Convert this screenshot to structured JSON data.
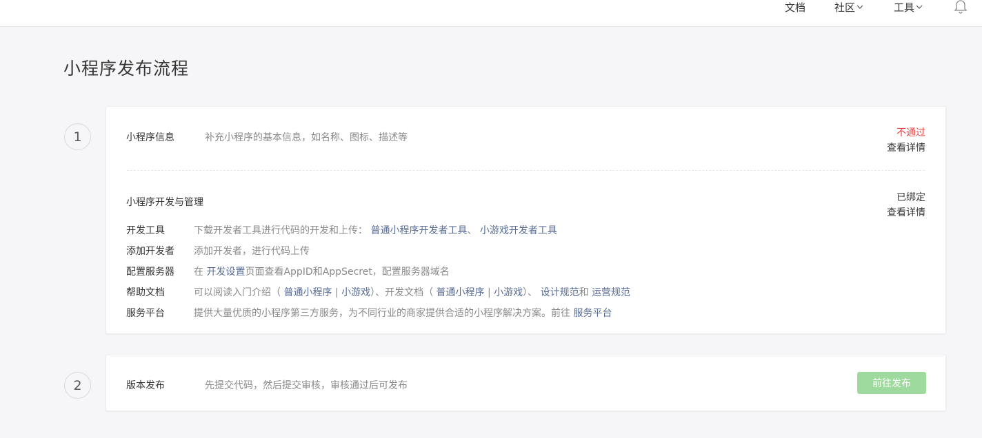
{
  "topbar": {
    "docs": "文档",
    "community": "社区",
    "tools": "工具"
  },
  "page": {
    "title": "小程序发布流程"
  },
  "steps": [
    {
      "number": "1",
      "info": {
        "label": "小程序信息",
        "desc": "补充小程序的基本信息，如名称、图标、描述等",
        "status": "不通过",
        "detail": "查看详情"
      },
      "dev": {
        "label": "小程序开发与管理",
        "status": "已绑定",
        "detail": "查看详情",
        "rows": [
          {
            "label": "开发工具",
            "text1": "下载开发者工具进行代码的开发和上传：",
            "link1": "普通小程序开发者工具",
            "sep1": "、",
            "link2": "小游戏开发者工具"
          },
          {
            "label": "添加开发者",
            "text1": "添加开发者，进行代码上传"
          },
          {
            "label": "配置服务器",
            "text1": "在",
            "link1": "开发设置",
            "text2": "页面查看AppID和AppSecret，配置服务器域名"
          },
          {
            "label": "帮助文档",
            "text1": "可以阅读入门介绍（",
            "link1": "普通小程序",
            "sep1": "|",
            "link2": "小游戏",
            "text2": "）、开发文档（",
            "link3": "普通小程序",
            "sep2": "|",
            "link4": "小游戏",
            "text3": "）、",
            "link5": "设计规范",
            "text4": "和",
            "link6": "运营规范"
          },
          {
            "label": "服务平台",
            "text1": "提供大量优质的小程序第三方服务，为不同行业的商家提供合适的小程序解决方案。前往",
            "link1": "服务平台"
          }
        ]
      }
    },
    {
      "number": "2",
      "label": "版本发布",
      "desc": "先提交代码，然后提交审核，审核通过后可发布",
      "button": "前往发布"
    }
  ],
  "colors": {
    "link": "#576b95",
    "fail": "#e64340",
    "button_disabled": "#9ed99d"
  }
}
